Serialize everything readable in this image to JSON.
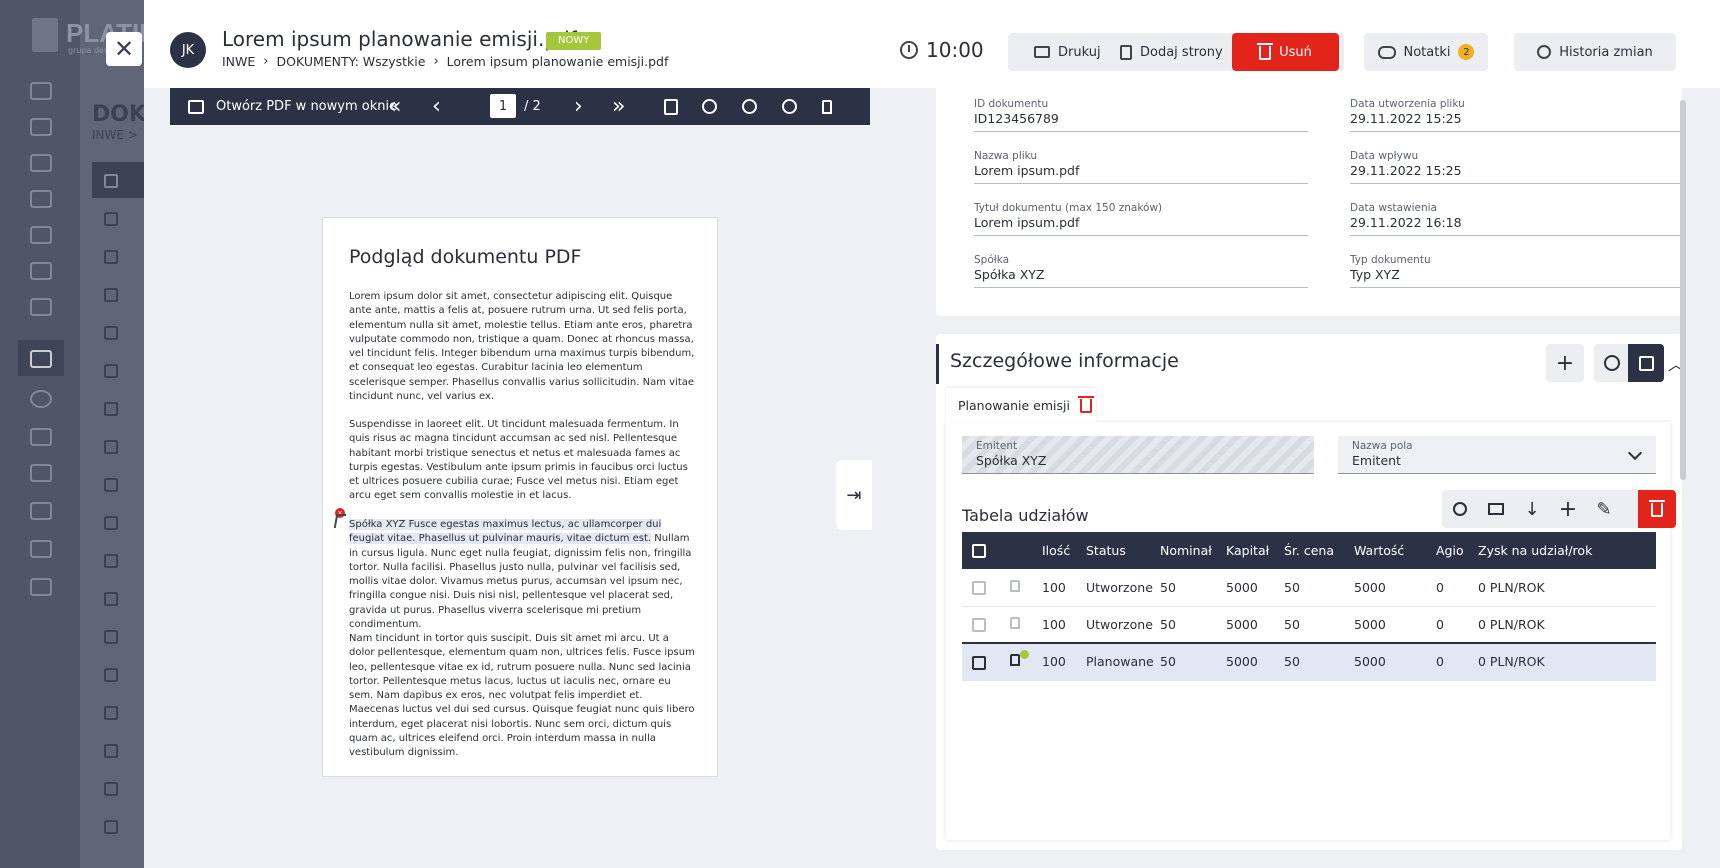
{
  "background": {
    "logo_text": "PLATIN",
    "logo_sub": "grupa dev",
    "page_title": "DOKU",
    "breadcrumb": "INWE >"
  },
  "header": {
    "avatar_initials": "JK",
    "doc_title": "Lorem ipsum planowanie emisji.pdf",
    "badge": "NOWY",
    "breadcrumb": [
      "INWE",
      "DOKUMENTY: Wszystkie",
      "Lorem ipsum planowanie emisji.pdf"
    ],
    "timer": "10:00",
    "print_label": "Drukuj",
    "add_pages_label": "Dodaj strony",
    "delete_label": "Usuń",
    "notes_label": "Notatki",
    "notes_count": "2",
    "history_label": "Historia zmian"
  },
  "viewer": {
    "open_new_window": "Otwórz PDF w nowym oknie",
    "page": "1",
    "total": "/ 2",
    "doc_heading": "Podgląd dokumentu PDF",
    "paragraphs": [
      "Lorem ipsum dolor sit amet, consectetur adipiscing elit. Quisque ante ante, mattis a felis at, posuere rutrum urna. Ut sed felis porta, elementum nulla sit amet, molestie tellus. Etiam ante eros, pharetra vulputate commodo non, tristique a quam. Donec at rhoncus massa, vel tincidunt felis. Integer bibendum urna maximus turpis bibendum, et consequat leo egestas. Curabitur lacinia leo elementum scelerisque semper. Phasellus convallis varius sollicitudin. Nam vitae tincidunt nunc, vel varius ex.",
      "Suspendisse in laoreet elit. Ut tincidunt malesuada fermentum. In quis risus ac magna tincidunt accumsan ac sed nisl. Pellentesque habitant morbi tristique senectus et netus et malesuada fames ac turpis egestas. Vestibulum ante ipsum primis in faucibus orci luctus et ultrices posuere cubilia curae; Fusce vel metus nisi. Etiam eget arcu eget sem convallis molestie in et lacus.",
      "Nam tincidunt in tortor quis suscipit. Duis sit amet mi arcu. Ut a dolor pellentesque, elementum quam non, ultrices felis. Fusce ipsum leo, pellentesque vitae ex id, rutrum posuere nulla. Nunc sed lacinia tortor. Pellentesque metus lacus, luctus ut iaculis nec, ornare eu sem. Nam dapibus ex eros, nec volutpat felis imperdiet et. Maecenas luctus vel dui sed cursus. Quisque feugiat nunc quis libero interdum, eget placerat nisi lobortis. Nunc sem orci, dictum quis quam ac, ultrices eleifend orci. Proin interdum massa in nulla vestibulum dignissim."
    ],
    "highlight": "Spółka XYZ Fusce egestas maximus lectus, ac ullamcorper dui feugiat vitae. Phasellus ut pulvinar mauris, vitae dictum est.",
    "after_highlight": " Nullam in cursus ligula. Nunc eget nulla feugiat, dignissim felis non, fringilla tortor. Nulla facilisi. Phasellus justo nulla, pulvinar vel facilisis sed, mollis vitae dolor. Vivamus metus purus, accumsan vel ipsum nec, fringilla congue nisi. Duis nisi nisl, pellentesque vel placerat sed, gravida ut purus. Phasellus viverra scelerisque mi pretium condimentum.",
    "marker": "×"
  },
  "meta": {
    "fields_left": [
      {
        "label": "ID dokumentu",
        "value": "ID123456789"
      },
      {
        "label": "Nazwa pliku",
        "value": "Lorem ipsum.pdf"
      },
      {
        "label": "Tytuł dokumentu (max 150 znaków)",
        "value": "Lorem ipsum.pdf"
      },
      {
        "label": "Spółka",
        "value": "Spółka XYZ"
      }
    ],
    "fields_right": [
      {
        "label": "Data utworzenia pliku",
        "value": "29.11.2022  15:25"
      },
      {
        "label": "Data wpływu",
        "value": "29.11.2022  15:25"
      },
      {
        "label": "Data wstawienia",
        "value": "29.11.2022  16:18"
      },
      {
        "label": "Typ dokumentu",
        "value": "Typ XYZ"
      }
    ]
  },
  "details": {
    "title": "Szczegółowe informacje",
    "tab_label": "Planowanie emisji",
    "emitent_label": "Emitent",
    "emitent_value": "Spółka XYZ",
    "field_name_label": "Nazwa pola",
    "field_name_value": "Emitent",
    "table_title": "Tabela udziałów",
    "columns": [
      "Ilość",
      "Status",
      "Nominał",
      "Kapitał",
      "Śr. cena",
      "Wartość",
      "Agio",
      "Zysk na udział/rok"
    ],
    "rows": [
      {
        "ilosc": "100",
        "status": "Utworzone",
        "nominal": "50",
        "kapital": "5000",
        "cena": "50",
        "wartosc": "5000",
        "agio": "0",
        "zysk": "0 PLN/ROK"
      },
      {
        "ilosc": "100",
        "status": "Utworzone",
        "nominal": "50",
        "kapital": "5000",
        "cena": "50",
        "wartosc": "5000",
        "agio": "0",
        "zysk": "0 PLN/ROK"
      },
      {
        "ilosc": "100",
        "status": "Planowane",
        "nominal": "50",
        "kapital": "5000",
        "cena": "50",
        "wartosc": "5000",
        "agio": "0",
        "zysk": "0 PLN/ROK"
      }
    ]
  },
  "colors": {
    "accent_dark": "#2b3245",
    "danger": "#e3241b",
    "badge_new": "#a5c73c",
    "notes_badge": "#f2b01e"
  }
}
